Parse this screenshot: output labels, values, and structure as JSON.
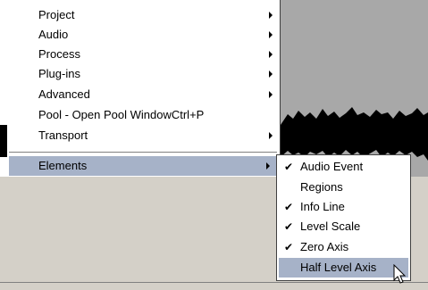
{
  "menu": {
    "items": [
      {
        "label": "Project",
        "submenu": true
      },
      {
        "label": "Audio",
        "submenu": true
      },
      {
        "label": "Process",
        "submenu": true
      },
      {
        "label": "Plug-ins",
        "submenu": true
      },
      {
        "label": "Advanced",
        "submenu": true
      },
      {
        "label": "Pool - Open Pool WindowCtrl+P",
        "submenu": false
      },
      {
        "label": "Transport",
        "submenu": true
      },
      {
        "label": "Elements",
        "submenu": true,
        "highlighted": true
      }
    ]
  },
  "submenu": {
    "items": [
      {
        "label": "Audio Event",
        "checked": true
      },
      {
        "label": "Regions",
        "checked": false
      },
      {
        "label": "Info Line",
        "checked": true
      },
      {
        "label": "Level Scale",
        "checked": true
      },
      {
        "label": "Zero Axis",
        "checked": true
      },
      {
        "label": "Half Level Axis",
        "checked": false,
        "highlighted": true
      }
    ],
    "check_glyph": "✔"
  },
  "colors": {
    "highlight": "#a6b2c8",
    "menu_bg": "#ffffff",
    "app_bg": "#d4d0c8",
    "waveform_bg": "#a8a8a8"
  },
  "icons": {
    "submenu_arrow": "chevron-right-icon",
    "check": "checkmark-icon",
    "cursor": "mouse-pointer-icon"
  }
}
